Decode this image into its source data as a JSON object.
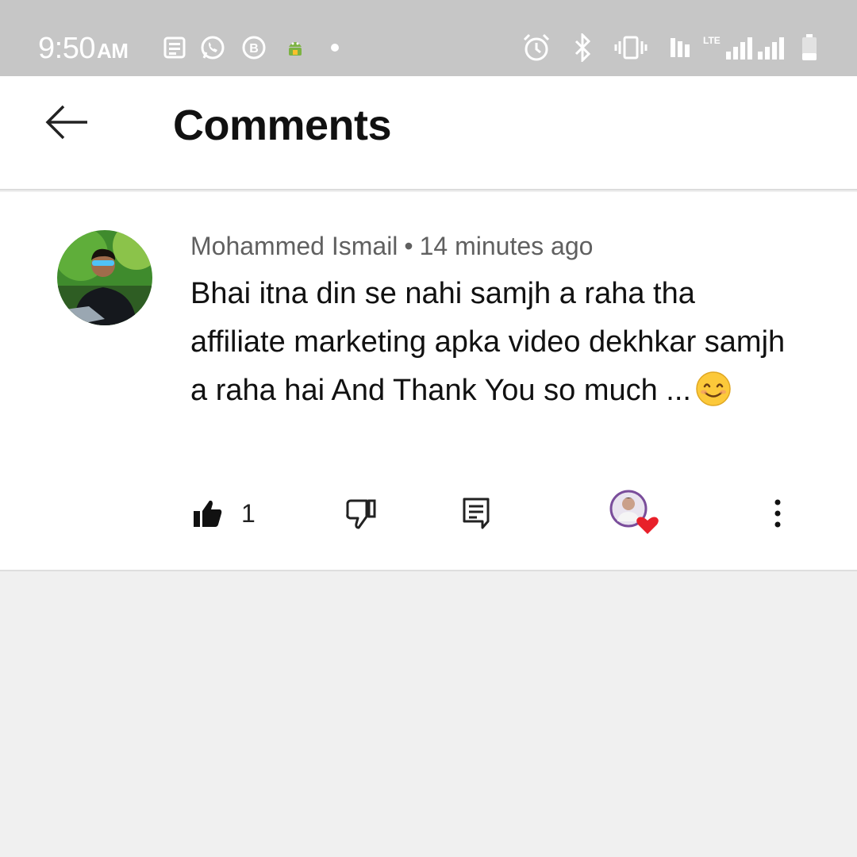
{
  "status_bar": {
    "time": "9:50",
    "ampm": "AM",
    "network_label": "LTE",
    "icons": [
      "news-icon",
      "whatsapp-icon",
      "b-icon",
      "android-icon",
      "dot-icon",
      "alarm-icon",
      "bluetooth-icon",
      "vibrate-icon",
      "volte-icon",
      "signal-icon",
      "battery-icon"
    ]
  },
  "header": {
    "title": "Comments",
    "back_icon": "back-arrow-icon"
  },
  "comment": {
    "author": "Mohammed Ismail",
    "separator": "•",
    "time_ago": "14 minutes ago",
    "text": "Bhai itna din se nahi samjh a raha tha affiliate marketing apka video dekhkar samjh a raha hai And Thank You so much ...",
    "emoji": "smiling-face-icon",
    "like_count": "1",
    "actions": [
      "like-icon",
      "dislike-icon",
      "reply-icon",
      "creator-heart-icon",
      "more-options-icon"
    ]
  },
  "colors": {
    "status_bar_bg": "#c6c6c6",
    "header_bg": "#ffffff",
    "page_bg": "#f0f0f0",
    "heart": "#e8202a",
    "meta_text": "#606060"
  }
}
